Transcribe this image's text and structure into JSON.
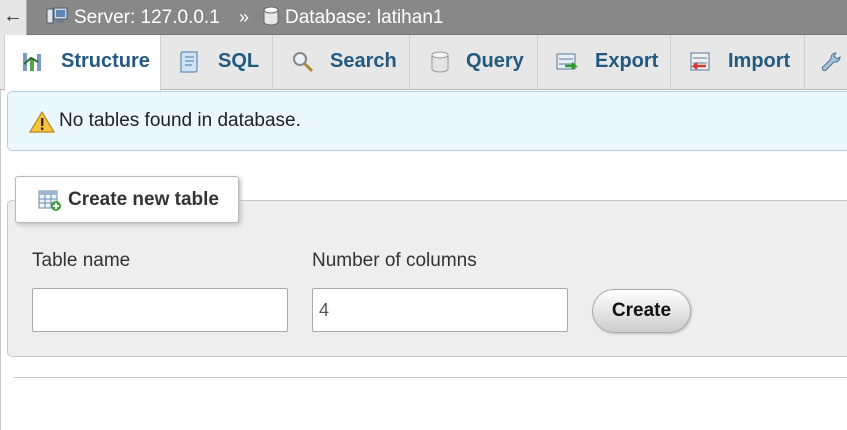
{
  "breadcrumb": {
    "back_label": "←",
    "server": "Server: 127.0.0.1",
    "separator": "»",
    "database": "Database: latihan1"
  },
  "tabs": [
    {
      "label": "Structure",
      "icon": "structure-icon",
      "active": true
    },
    {
      "label": "SQL",
      "icon": "sql-icon",
      "active": false
    },
    {
      "label": "Search",
      "icon": "search-icon",
      "active": false
    },
    {
      "label": "Query",
      "icon": "query-icon",
      "active": false
    },
    {
      "label": "Export",
      "icon": "export-icon",
      "active": false
    },
    {
      "label": "Import",
      "icon": "import-icon",
      "active": false
    },
    {
      "label": "",
      "icon": "wrench-icon",
      "active": false
    }
  ],
  "notice": {
    "icon": "warning-icon",
    "text": "No tables found in database."
  },
  "create_table": {
    "legend": "Create new table",
    "table_name_label": "Table name",
    "table_name_value": "",
    "columns_label": "Number of columns",
    "columns_value": "4",
    "create_button": "Create"
  },
  "colors": {
    "topbar": "#888888",
    "tab_text": "#235a81",
    "tab_bar": "#e7e7e7",
    "notice_bg": "#ebf8ff",
    "fieldset_bg": "#eeeeee"
  }
}
